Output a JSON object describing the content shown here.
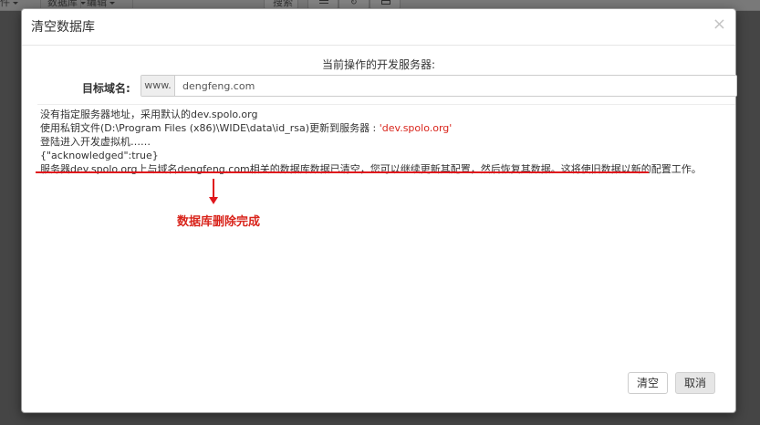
{
  "background": {
    "menu_items": [
      "件",
      "数据库",
      "编辑"
    ],
    "search_button": "搜索"
  },
  "modal": {
    "title": "清空数据库",
    "close_icon": "×",
    "server_label": "当前操作的开发服务器:",
    "domain": {
      "label": "目标域名:",
      "prefix": "www.",
      "value": "dengfeng.com"
    },
    "console_lines": [
      {
        "text": "没有指定服务器地址，采用默认的dev.spolo.org"
      },
      {
        "text": "使用私钥文件(D:\\Program Files (x86)\\WIDE\\data\\id_rsa)更新到服务器 : ",
        "highlight": "'dev.spolo.org'"
      },
      {
        "text": "登陆进入开发虚拟机……"
      },
      {
        "text": "{\"acknowledged\":true}"
      },
      {
        "text": "服务器dev.spolo.org上与域名dengfeng.com相关的数据库数据已清空，您可以继续更新其配置，然后恢复其数据。这将使旧数据以新的配置工作。"
      }
    ],
    "annotation": "数据库删除完成",
    "buttons": {
      "clear": "清空",
      "cancel": "取消"
    }
  },
  "colors": {
    "annotation_red": "#d9251c",
    "overlay": "#7f7f7f"
  }
}
